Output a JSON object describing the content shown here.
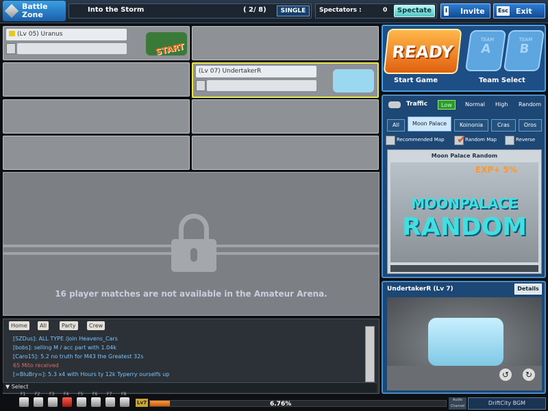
{
  "topbar": {
    "logo_line1": "Battle",
    "logo_line2": "Zone",
    "room_title": "Into the Storm",
    "room_count": "( 2/ 8)",
    "room_mode": "SINGLE",
    "spectators_label": "Spectators :",
    "spectators_value": "0",
    "spectate_label": "Spectate",
    "invite_key": "I",
    "invite_label": "Invite",
    "exit_key": "Esc",
    "exit_label": "Exit"
  },
  "slots": [
    {
      "name": "(Lv 05) Uranus",
      "badge": "START",
      "car_color": "#3a7a38"
    },
    {
      "name": "(Lv 07) UndertakerR",
      "car_color": "#9ad8f0"
    }
  ],
  "locked_message": "16 player matches are not available in the Amateur Arena.",
  "chat": {
    "tabs": [
      "Home",
      "All",
      "Party",
      "Crew"
    ],
    "lines": [
      "[SZDus]: ALL TYPE /join Heavens_Cars",
      "[bobs]: selling M / acc part with 1.04k",
      "[Caro15]: 5.2 no truth for M43 the Greatest 32s",
      "65 Mito received",
      "[=BluBry=]: 5.3 x4 with Hours ty 12k Typerry ourselfs up"
    ],
    "select_label": "Select"
  },
  "bottombar": {
    "fkeys": [
      "F1",
      "F2",
      "F3",
      "F4",
      "F5",
      "F6",
      "F7",
      "F8"
    ],
    "level": "Lv7",
    "exp_percent": "6.76%",
    "exp_fraction": 0.0676,
    "audio_label": "Audio Channel",
    "bgm_label": "DriftCity BGM"
  },
  "ready_panel": {
    "ready_label": "READY",
    "team_word": "TEAM",
    "team_a": "A",
    "team_b": "B",
    "start_game_label": "Start Game",
    "team_select_label": "Team Select"
  },
  "map_panel": {
    "traffic_label": "Traffic",
    "traffic_options": [
      "Low",
      "Normal",
      "High",
      "Random"
    ],
    "traffic_selected": "Low",
    "tabs": [
      "All",
      "Moon Palace",
      "Koinonia",
      "Cras",
      "Oros"
    ],
    "tab_selected": "Moon Palace",
    "recommended_label": "Recommended Map",
    "random_label": "Random Map",
    "reverse_label": "Reverse",
    "map_name": "Moon Palace Random",
    "exp_bonus": "EXP+ 5%",
    "map_title_line1": "MOONPALACE",
    "map_title_line2": "RANDOM"
  },
  "car_panel": {
    "owner": "UndertakerR (Lv 7)",
    "details_label": "Details"
  }
}
